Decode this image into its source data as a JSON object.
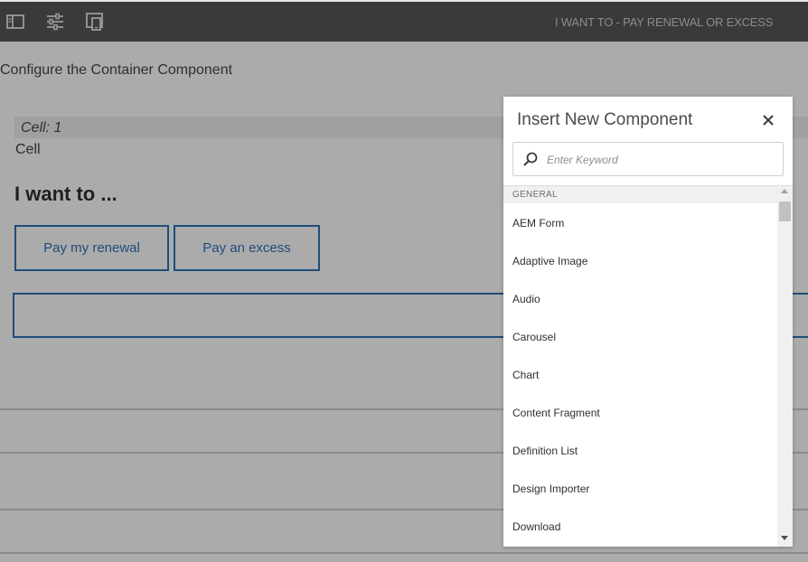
{
  "toolbar": {
    "icons": [
      "side-panel-icon",
      "properties-icon",
      "emulator-icon"
    ],
    "page_title": "I WANT TO - PAY RENEWAL OR EXCESS"
  },
  "editor": {
    "configure_title": "Configure the Container Component",
    "cell_label": "Cell: 1",
    "cell_text": "Cell",
    "heading": "I want to ...",
    "buttons": [
      "Pay my renewal",
      "Pay an excess"
    ]
  },
  "dialog": {
    "title": "Insert New Component",
    "search_placeholder": "Enter Keyword",
    "search_value": "",
    "group": "GENERAL",
    "items": [
      "AEM Form",
      "Adaptive Image",
      "Audio",
      "Carousel",
      "Chart",
      "Content Fragment",
      "Definition List",
      "Design Importer",
      "Download"
    ]
  },
  "colors": {
    "toolbar_bg": "#3a3a3a",
    "overlay_bg": "#ababab",
    "accent_blue": "#1f4d79",
    "dialog_bg": "#ffffff"
  }
}
